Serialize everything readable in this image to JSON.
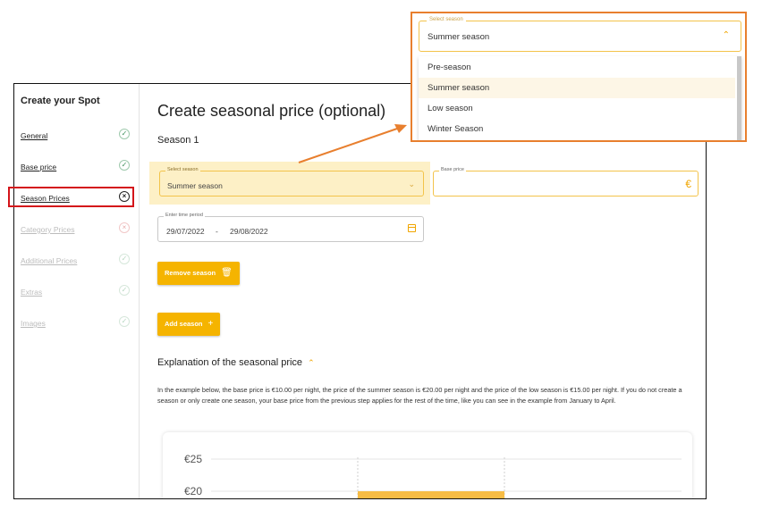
{
  "sidebar": {
    "title": "Create your Spot",
    "items": [
      {
        "label": "General",
        "status": "ok",
        "status_glyph": "✓"
      },
      {
        "label": "Base price",
        "status": "ok",
        "status_glyph": "✓"
      },
      {
        "label": "Season Prices",
        "status": "error",
        "status_glyph": "×"
      },
      {
        "label": "Category Prices",
        "status": "error",
        "status_glyph": "×"
      },
      {
        "label": "Additional Prices",
        "status": "ok",
        "status_glyph": "✓"
      },
      {
        "label": "Extras",
        "status": "ok",
        "status_glyph": "✓"
      },
      {
        "label": "Images",
        "status": "ok",
        "status_glyph": "✓"
      }
    ]
  },
  "main": {
    "title": "Create seasonal price (optional)",
    "season_title": "Season 1",
    "select_season": {
      "label": "Select season",
      "value": "Summer season"
    },
    "base_price": {
      "label": "Base price",
      "value": "",
      "currency": "€"
    },
    "time_period": {
      "label": "Enter time period",
      "start": "29/07/2022",
      "separator": "-",
      "end": "29/08/2022"
    },
    "remove_button": "Remove season",
    "add_button": "Add season",
    "add_icon": "+",
    "explanation": {
      "title": "Explanation of the seasonal price",
      "text": "In the example below, the base price is €10.00 per night, the price of the summer season is €20.00 per night and the price of the low season is €15.00 per night. If you do not create a season or only create one season, your base price from the previous step applies for the rest of the time, like you can see in the example from January to April."
    }
  },
  "chart_data": {
    "type": "bar",
    "y_tick_labels": [
      "€25",
      "€20"
    ],
    "y_ticks": [
      25,
      20
    ],
    "bars": [
      {
        "value": 20
      }
    ],
    "bar_color": "#f7bc45"
  },
  "dropdown_popup": {
    "label": "Select season",
    "value": "Summer season",
    "options": [
      "Pre-season",
      "Summer season",
      "Low season",
      "Winter Season"
    ],
    "selected_index": 1
  },
  "colors": {
    "accent": "#f5b400",
    "highlight_red": "#d4141a",
    "callout_orange": "#e87f2e",
    "select_highlight": "#fdf0c6"
  }
}
